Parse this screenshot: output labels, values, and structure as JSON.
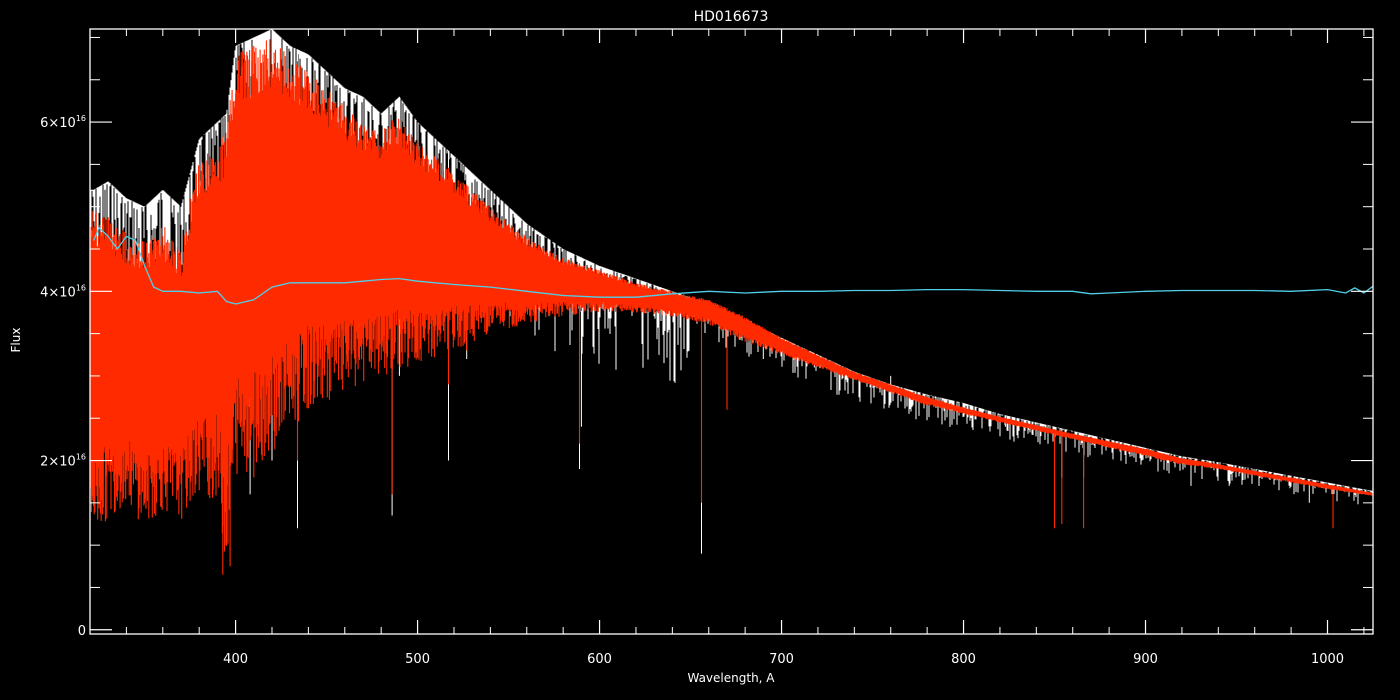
{
  "chart_data": {
    "type": "line",
    "title": "HD016673",
    "xlabel": "Wavelength, A",
    "ylabel": "Flux",
    "xlim": [
      320,
      1025
    ],
    "ylim": [
      -500000000000000.0,
      7.1e+16
    ],
    "x_ticks": [
      {
        "value": 400,
        "label": "400"
      },
      {
        "value": 500,
        "label": "500"
      },
      {
        "value": 600,
        "label": "600"
      },
      {
        "value": 700,
        "label": "700"
      },
      {
        "value": 800,
        "label": "800"
      },
      {
        "value": 900,
        "label": "900"
      },
      {
        "value": 1000,
        "label": "1000"
      }
    ],
    "y_ticks": [
      {
        "value": 0,
        "label": "0",
        "exp": ""
      },
      {
        "value": 2e+16,
        "label": "2×10",
        "exp": "16"
      },
      {
        "value": 4e+16,
        "label": "4×10",
        "exp": "16"
      },
      {
        "value": 6e+16,
        "label": "6×10",
        "exp": "16"
      }
    ],
    "x_minor_step": 20,
    "y_minor_step": 5000000000000000.0,
    "grid": false,
    "colors": {
      "background": "#000000",
      "axes": "#ffffff",
      "observed": "#ffffff",
      "model": "#ff2a00",
      "ratio": "#4fd0e8"
    },
    "series": [
      {
        "key": "observed",
        "x": [
          322,
          330,
          340,
          350,
          360,
          370,
          380,
          390,
          395,
          400,
          410,
          420,
          430,
          440,
          450,
          460,
          470,
          480,
          490,
          500,
          520,
          540,
          560,
          580,
          600,
          620,
          640,
          660,
          680,
          700,
          720,
          740,
          760,
          780,
          800,
          820,
          840,
          860,
          880,
          900,
          920,
          940,
          960,
          980,
          1000,
          1010,
          1020,
          1025
        ],
        "y": [
          5.2e+16,
          5.3e+16,
          5.1e+16,
          5e+16,
          5.2e+16,
          5e+16,
          5.8e+16,
          6e+16,
          6.1e+16,
          6.9e+16,
          7e+16,
          7.1e+16,
          6.9e+16,
          6.8e+16,
          6.6e+16,
          6.4e+16,
          6.3e+16,
          6.1e+16,
          6.3e+16,
          6e+16,
          5.6e+16,
          5.2e+16,
          4.8e+16,
          4.5e+16,
          4.3e+16,
          4.15e+16,
          4e+16,
          3.85e+16,
          3.65e+16,
          3.45e+16,
          3.25e+16,
          3.05e+16,
          2.9e+16,
          2.78e+16,
          2.68e+16,
          2.55e+16,
          2.45e+16,
          2.35e+16,
          2.25e+16,
          2.15e+16,
          2.05e+16,
          1.98e+16,
          1.9e+16,
          1.82e+16,
          1.74e+16,
          1.7e+16,
          1.66e+16,
          1.64e+16
        ],
        "lines": [
          [
            395,
            1.3e+16
          ],
          [
            408,
            1.6e+16
          ],
          [
            420,
            2e+16
          ],
          [
            434,
            1.2e+16
          ],
          [
            438,
            3e+16
          ],
          [
            486,
            1.35e+16
          ],
          [
            490,
            3e+16
          ],
          [
            517,
            2e+16
          ],
          [
            527,
            3.2e+16
          ],
          [
            589,
            1.9e+16
          ],
          [
            590,
            2.4e+16
          ],
          [
            656,
            9000000000000000.0
          ],
          [
            690,
            3.2e+16
          ],
          [
            718,
            3.1e+16
          ],
          [
            760,
            3e+16
          ],
          [
            823,
            2.4e+16
          ],
          [
            850,
            1.7e+16
          ],
          [
            854,
            1.8e+16
          ],
          [
            866,
            1.8e+16
          ],
          [
            898,
            2e+16
          ],
          [
            925,
            1.7e+16
          ],
          [
            946,
            1.7e+16
          ],
          [
            990,
            1.5e+16
          ],
          [
            1003,
            1.4e+16
          ]
        ]
      },
      {
        "key": "model",
        "x": [
          322,
          330,
          340,
          350,
          360,
          370,
          380,
          390,
          395,
          400,
          410,
          420,
          430,
          440,
          450,
          460,
          470,
          480,
          490,
          500,
          520,
          540,
          560,
          580,
          600,
          620,
          640,
          660,
          680,
          700,
          720,
          740,
          760,
          780,
          800,
          820,
          840,
          860,
          880,
          900,
          920,
          940,
          960,
          980,
          1000,
          1010,
          1020,
          1025
        ],
        "y": [
          5e+16,
          4.9e+16,
          4.7e+16,
          4.6e+16,
          4.8e+16,
          4.5e+16,
          5.6e+16,
          5.7e+16,
          5.9e+16,
          6.8e+16,
          6.9e+16,
          7e+16,
          6.8e+16,
          6.6e+16,
          6.4e+16,
          6.2e+16,
          6e+16,
          5.9e+16,
          6.1e+16,
          5.8e+16,
          5.4e+16,
          5e+16,
          4.65e+16,
          4.4e+16,
          4.25e+16,
          4.1e+16,
          4e+16,
          3.9e+16,
          3.7e+16,
          3.45e+16,
          3.25e+16,
          3.05e+16,
          2.9e+16,
          2.75e+16,
          2.63e+16,
          2.52e+16,
          2.42e+16,
          2.32e+16,
          2.23e+16,
          2.14e+16,
          2.03e+16,
          1.96e+16,
          1.88e+16,
          1.8e+16,
          1.72e+16,
          1.68e+16,
          1.64e+16,
          1.62e+16
        ],
        "bottom": [
          322,
          1.1e+16,
          330,
          1.3e+16,
          340,
          1.5e+16,
          350,
          1.2e+16,
          360,
          1.4e+16,
          370,
          1.3e+16,
          380,
          1.6e+16,
          390,
          1.5e+16,
          395,
          7000000000000000.0,
          400,
          1.8e+16,
          410,
          1.9e+16,
          420,
          2.1e+16,
          430,
          2.3e+16,
          440,
          2.6e+16,
          450,
          2.7e+16,
          460,
          2.8e+16,
          470,
          2.9e+16,
          480,
          3e+16,
          500,
          3.1e+16,
          520,
          3.3e+16,
          540,
          3.5e+16,
          560,
          3.6e+16,
          580,
          3.7e+16,
          600,
          3.75e+16,
          620,
          3.75e+16,
          640,
          3.7e+16,
          660,
          3.6e+16,
          680,
          3.4e+16,
          700,
          3.25e+16,
          720,
          3.1e+16,
          740,
          2.95e+16,
          760,
          2.8e+16,
          780,
          2.65e+16,
          800,
          2.55e+16,
          820,
          2.45e+16,
          840,
          2.35e+16,
          860,
          2.25e+16,
          880,
          2.15e+16,
          900,
          2.05e+16,
          920,
          1.95e+16,
          940,
          1.9e+16,
          960,
          1.82e+16,
          980,
          1.74e+16,
          1000,
          1.66e+16,
          1025,
          1.58e+16
        ],
        "lines": [
          [
            393,
            6500000000000000.0
          ],
          [
            397,
            7500000000000000.0
          ],
          [
            410,
            1.8e+16
          ],
          [
            434,
            2e+16
          ],
          [
            486,
            1.6e+16
          ],
          [
            517,
            2.9e+16
          ],
          [
            527,
            3.3e+16
          ],
          [
            589,
            2.2e+16
          ],
          [
            656,
            1.5e+16
          ],
          [
            670,
            2.6e+16
          ],
          [
            850,
            1.2e+16
          ],
          [
            854,
            1.25e+16
          ],
          [
            866,
            1.2e+16
          ],
          [
            1003,
            1.2e+16
          ]
        ]
      },
      {
        "key": "ratio",
        "x": [
          322,
          325,
          330,
          335,
          340,
          345,
          350,
          355,
          360,
          370,
          380,
          390,
          395,
          400,
          410,
          420,
          430,
          440,
          450,
          460,
          470,
          480,
          490,
          500,
          520,
          540,
          560,
          580,
          600,
          620,
          640,
          660,
          680,
          700,
          720,
          740,
          760,
          780,
          800,
          820,
          840,
          860,
          870,
          880,
          900,
          920,
          940,
          960,
          980,
          1000,
          1010,
          1015,
          1020,
          1025
        ],
        "y": [
          4.6e+16,
          4.75e+16,
          4.65e+16,
          4.5e+16,
          4.65e+16,
          4.6e+16,
          4.3e+16,
          4.05e+16,
          4e+16,
          4e+16,
          3.98e+16,
          4e+16,
          3.88e+16,
          3.85e+16,
          3.9e+16,
          4.05e+16,
          4.1e+16,
          4.1e+16,
          4.1e+16,
          4.1e+16,
          4.12e+16,
          4.14e+16,
          4.15e+16,
          4.12e+16,
          4.08e+16,
          4.05e+16,
          4e+16,
          3.95e+16,
          3.93e+16,
          3.93e+16,
          3.97e+16,
          4e+16,
          3.98e+16,
          4e+16,
          4e+16,
          4.01e+16,
          4.01e+16,
          4.02e+16,
          4.02e+16,
          4.01e+16,
          4e+16,
          4e+16,
          3.97e+16,
          3.98e+16,
          4e+16,
          4.01e+16,
          4.01e+16,
          4.01e+16,
          4e+16,
          4.02e+16,
          3.98e+16,
          4.04e+16,
          3.98e+16,
          4.06e+16
        ]
      }
    ]
  }
}
